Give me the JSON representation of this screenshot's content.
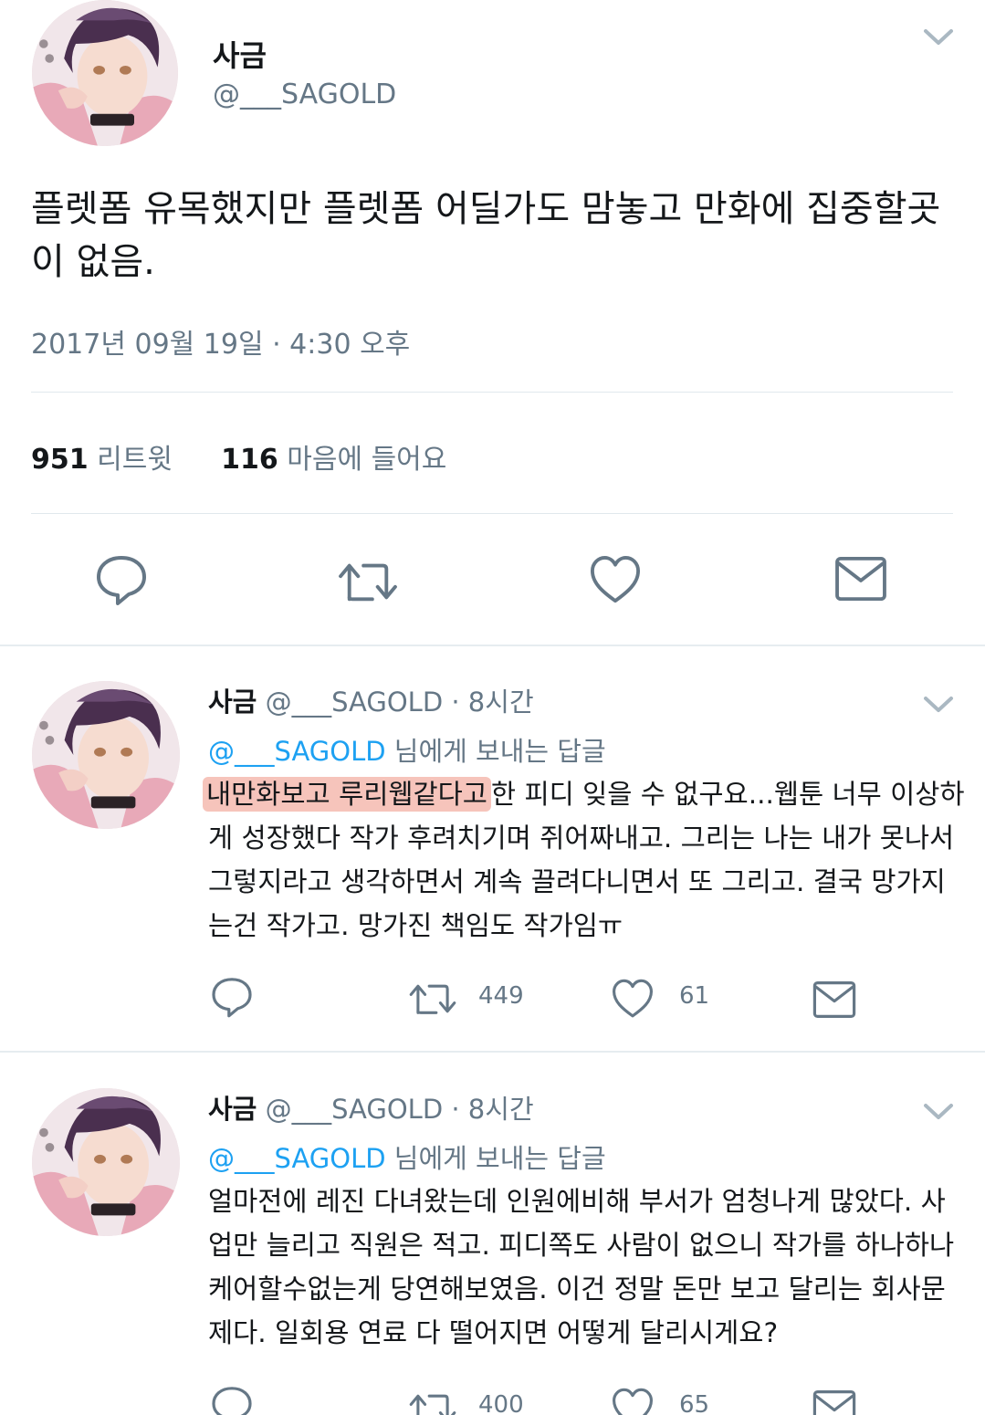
{
  "main_tweet": {
    "author_name": "사금",
    "author_handle": "@___SAGOLD",
    "text": "플렛폼 유목했지만 플렛폼 어딜가도 맘놓고 만화에 집중할곳이 없음.",
    "timestamp": "2017년 09월 19일 · 4:30 오후",
    "retweet_count": "951",
    "retweet_label": "리트윗",
    "like_count": "116",
    "like_label": "마음에 들어요"
  },
  "replies": [
    {
      "author_name": "사금",
      "author_handle": "@___SAGOLD",
      "time": "· 8시간",
      "reply_to_handle": "@___SAGOLD",
      "reply_to_suffix": "님에게 보내는 답글",
      "highlight": "내만화보고 루리웹같다고",
      "text_rest": "한 피디 잊을 수 없구요...웹툰 너무 이상하게 성장했다 작가 후려치기며 쥐어짜내고. 그리는 나는 내가 못나서 그렇지라고 생각하면서 계속 끌려다니면서 또 그리고. 결국 망가지는건 작가고. 망가진 책임도 작가임ㅠ",
      "retweets": "449",
      "likes": "61"
    },
    {
      "author_name": "사금",
      "author_handle": "@___SAGOLD",
      "time": "· 8시간",
      "reply_to_handle": "@___SAGOLD",
      "reply_to_suffix": "님에게 보내는 답글",
      "text": "얼마전에 레진 다녀왔는데 인원에비해 부서가 엄청나게 많았다. 사업만 늘리고 직원은 적고. 피디쪽도 사람이 없으니 작가를 하나하나 케어할수없는게 당연해보였음. 이건 정말 돈만 보고 달리는 회사문제다. 일회용 연료 다 떨어지면 어떻게 달리시게요?",
      "retweets": "400",
      "likes": "65"
    }
  ],
  "colors": {
    "text": "#14171a",
    "secondary": "#657786",
    "link": "#1da1f2",
    "divider": "#e1e8ed",
    "highlight": "#f6c4bb"
  },
  "icons": [
    "reply-icon",
    "retweet-icon",
    "like-icon",
    "direct-message-icon",
    "chevron-down-icon",
    "avatar"
  ]
}
